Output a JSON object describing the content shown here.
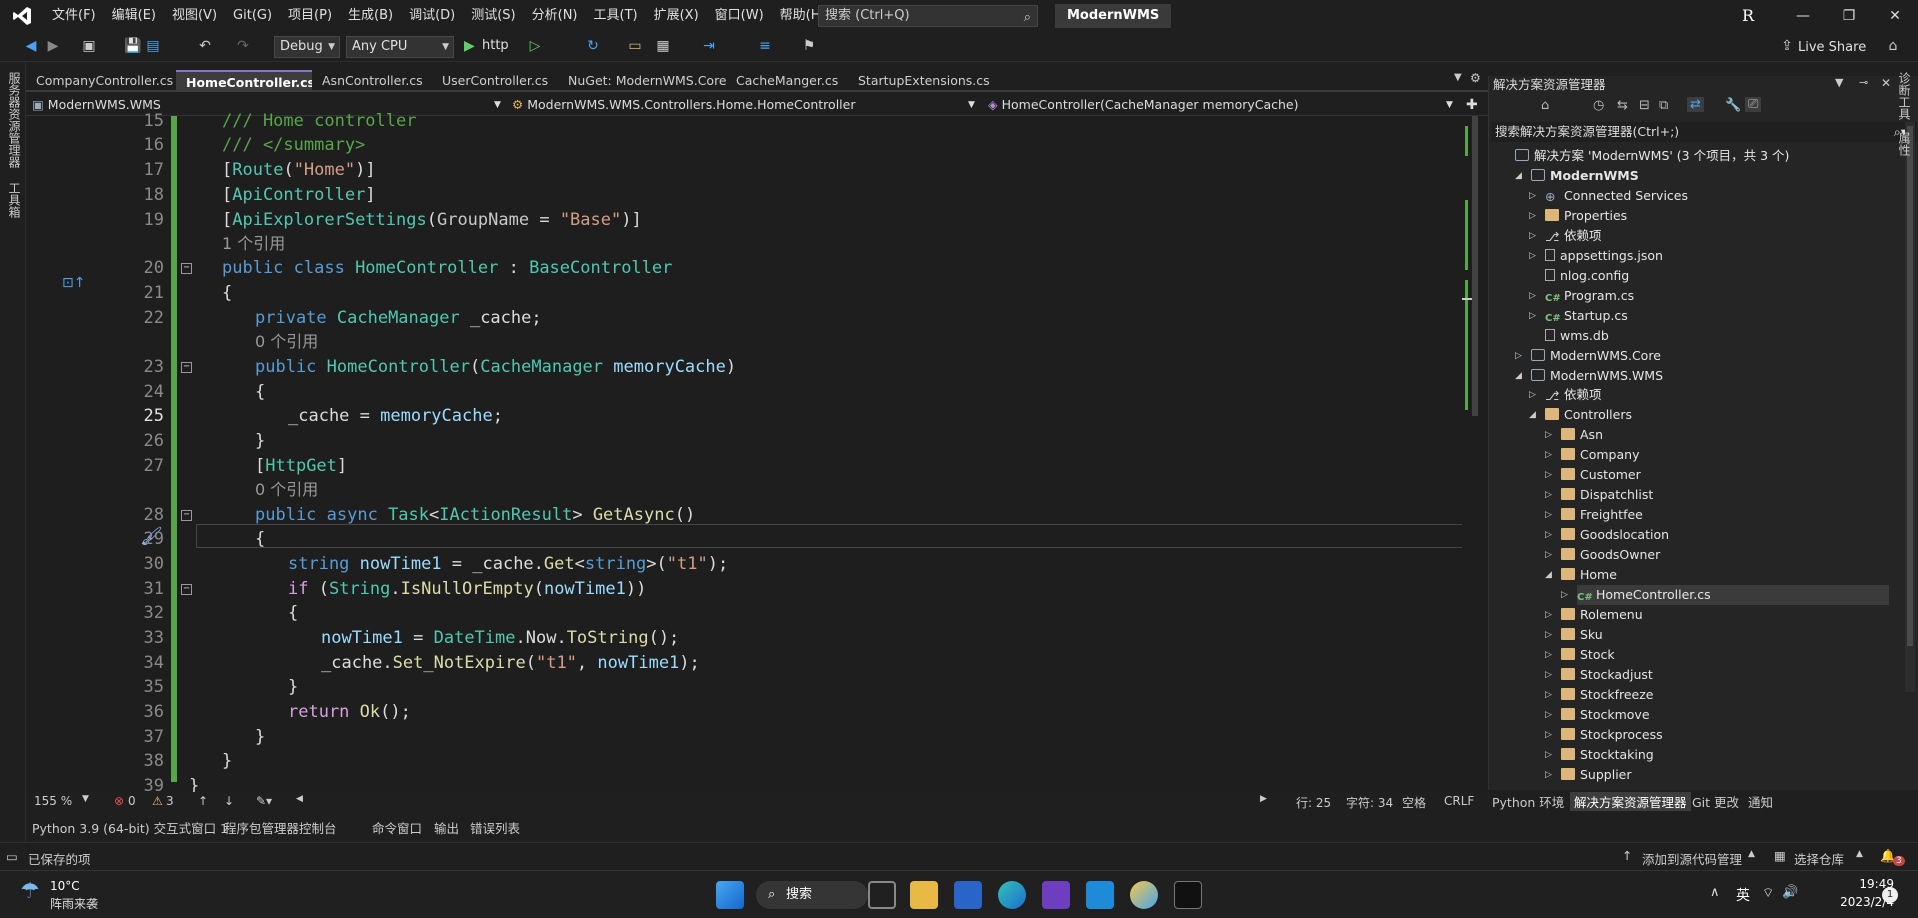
{
  "menu": {
    "items": [
      "文件(F)",
      "编辑(E)",
      "视图(V)",
      "Git(G)",
      "项目(P)",
      "生成(B)",
      "调试(D)",
      "测试(S)",
      "分析(N)",
      "工具(T)",
      "扩展(X)",
      "窗口(W)",
      "帮助(H)"
    ],
    "search_placeholder": "搜索 (Ctrl+Q)",
    "solution_title": "ModernWMS",
    "avatar_letter": "R"
  },
  "toolbar": {
    "config": "Debug",
    "platform": "Any CPU",
    "run_target": "http",
    "live_share": "Live Share"
  },
  "left_rail": {
    "server_explorer": "服务器资源管理器",
    "toolbox": "工具箱"
  },
  "right_rail": {
    "diagnostics": "诊断工具",
    "properties": "属性"
  },
  "tabs": [
    {
      "label": "CompanyController.cs"
    },
    {
      "label": "HomeController.cs"
    },
    {
      "label": "AsnController.cs"
    },
    {
      "label": "UserController.cs"
    },
    {
      "label": "NuGet: ModernWMS.Core"
    },
    {
      "label": "CacheManger.cs"
    },
    {
      "label": "StartupExtensions.cs*"
    }
  ],
  "nav": {
    "project": "ModernWMS.WMS",
    "class": "ModernWMS.WMS.Controllers.Home.HomeController",
    "member": "HomeController(CacheManager memoryCache)"
  },
  "editor": {
    "line_numbers": [
      "15",
      "16",
      "17",
      "18",
      "19",
      "20",
      "21",
      "22",
      "23",
      "24",
      "25",
      "26",
      "27",
      "28",
      "29",
      "30",
      "31",
      "32",
      "33",
      "34",
      "35",
      "36",
      "37",
      "38",
      "39"
    ],
    "current_line": "25",
    "lens_1": "1 个引用",
    "lens_0a": "0 个引用",
    "lens_0b": "0 个引用"
  },
  "editor_status": {
    "zoom": "155 %",
    "errors": "0",
    "warnings": "3",
    "line": "行: 25",
    "col": "字符: 34",
    "spacing": "空格",
    "eol": "CRLF"
  },
  "bottom_tabs": [
    "Python 3.9 (64-bit) 交互式窗口 1",
    "程序包管理器控制台",
    "命令窗口",
    "输出",
    "错误列表"
  ],
  "solution_explorer": {
    "title": "解决方案资源管理器",
    "search_placeholder": "搜索解决方案资源管理器(Ctrl+;)",
    "solution_node": "解决方案 'ModernWMS' (3 个项目，共 3 个)",
    "nodes": [
      {
        "label": "ModernWMS",
        "bold": true
      },
      {
        "label": "Connected Services"
      },
      {
        "label": "Properties"
      },
      {
        "label": "依赖项"
      },
      {
        "label": "appsettings.json"
      },
      {
        "label": "nlog.config"
      },
      {
        "label": "Program.cs"
      },
      {
        "label": "Startup.cs"
      },
      {
        "label": "wms.db"
      },
      {
        "label": "ModernWMS.Core"
      },
      {
        "label": "ModernWMS.WMS"
      },
      {
        "label": "依赖项"
      },
      {
        "label": "Controllers"
      },
      {
        "label": "Asn"
      },
      {
        "label": "Company"
      },
      {
        "label": "Customer"
      },
      {
        "label": "Dispatchlist"
      },
      {
        "label": "Freightfee"
      },
      {
        "label": "Goodslocation"
      },
      {
        "label": "GoodsOwner"
      },
      {
        "label": "Home"
      },
      {
        "label": "HomeController.cs"
      },
      {
        "label": "Rolemenu"
      },
      {
        "label": "Sku"
      },
      {
        "label": "Stock"
      },
      {
        "label": "Stockadjust"
      },
      {
        "label": "Stockfreeze"
      },
      {
        "label": "Stockmove"
      },
      {
        "label": "Stockprocess"
      },
      {
        "label": "Stocktaking"
      },
      {
        "label": "Supplier"
      }
    ],
    "bottom_tabs": [
      "Python 环境",
      "解决方案资源管理器",
      "Git 更改",
      "通知"
    ]
  },
  "status_bar": {
    "saved": "已保存的项",
    "add_source": "添加到源代码管理",
    "select_repo": "选择仓库",
    "notif_count": "3"
  },
  "taskbar": {
    "weather_temp": "10°C",
    "weather_desc": "阵雨来袭",
    "search": "搜索",
    "ime": "英",
    "time": "19:49",
    "date": "2023/2/4",
    "notif": "1"
  },
  "colors": {
    "accent": "#8f6fd4",
    "green_margin": "#57a64a",
    "keyword": "#569cd6",
    "type": "#4ec9b0"
  }
}
